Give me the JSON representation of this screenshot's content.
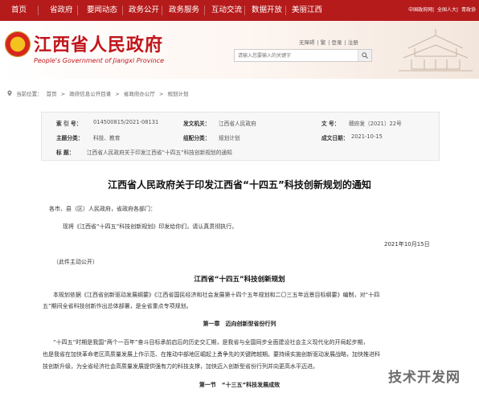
{
  "colors": {
    "nav_bg": "#b51b1b",
    "brand_red": "#c1151b"
  },
  "top_nav": {
    "items": [
      "首页",
      "省政府",
      "要闻动态",
      "政务公开",
      "政务服务",
      "互动交流",
      "数据开放",
      "美丽江西"
    ],
    "right_links": [
      "中国政府网",
      "全国人大",
      "青政协"
    ]
  },
  "header": {
    "site_name": "江西省人民政府",
    "site_name_en": "People's Government of Jiangxi Province",
    "emblem_icon": "national-emblem-icon",
    "util_links": [
      "无障碍",
      "繁",
      "登录",
      "注册"
    ],
    "search_placeholder": "请输入您要输入的关键字"
  },
  "breadcrumb": {
    "prefix": "当前位置：",
    "items": [
      "首页",
      "政府信息公开目录",
      "省政府办公厅",
      "规划计划"
    ],
    "separator": ">"
  },
  "meta": {
    "index_label": "索 引 号：",
    "index_value": "014500815/2021-08131",
    "issuer_label": "发文机关：",
    "issuer_value": "江西省人民政府",
    "docno_label": "文    号：",
    "docno_value": "赣府发〔2021〕22号",
    "topic_label": "主题分类：",
    "topic_value": "科技、教育",
    "category_label": "组配分类：",
    "category_value": "规划计划",
    "date_label": "成文日期：",
    "date_value": "2021-10-15",
    "title_label": "标    题：",
    "title_value": "江西省人民政府关于印发江西省“十四五”科技创新规划的通知"
  },
  "article": {
    "title": "江西省人民政府关于印发江西省“十四五”科技创新规划的通知",
    "salutation": "各市、县（区）人民政府，省政府各部门：",
    "body1": "现将《江西省“十四五”科技创新规划》印发给你们，请认真贯彻执行。",
    "date": "2021年10月15日",
    "note": "（此件主动公开）",
    "subtitle": "江西省“十四五”科技创新规划",
    "intro_line1": "本规划依据《江西省创新驱动发展纲要》《江西省国民经济和社会发展第十四个五年规划和二〇三五年远景目标纲要》编制，对“十四",
    "intro_line2": "五”期间全省科技创新作出总体部署，是全省重点专项规划。",
    "chapter1": "第一章　迈向创新型省份行列",
    "para1_line1": "“十四五”时期是我国“两个一百年”奋斗目标承前启后的历史交汇期，是我省与全国同步全面建设社会主义现代化的开局起步期，",
    "para1_line2": "也是我省在加快革命老区高质量发展上作示范、在推动中部地区崛起上勇争先的关键跨越期。要持续实施创新驱动发展战略，加快推进科",
    "para1_line3": "技创新升级，为全省经济社会高质量发展提供强有力的科技支撑，加快迈入创新型省份行列并向更高水平迈进。",
    "section1": "第一节　“十三五”科技发展成效"
  },
  "watermark": "技术开发网"
}
